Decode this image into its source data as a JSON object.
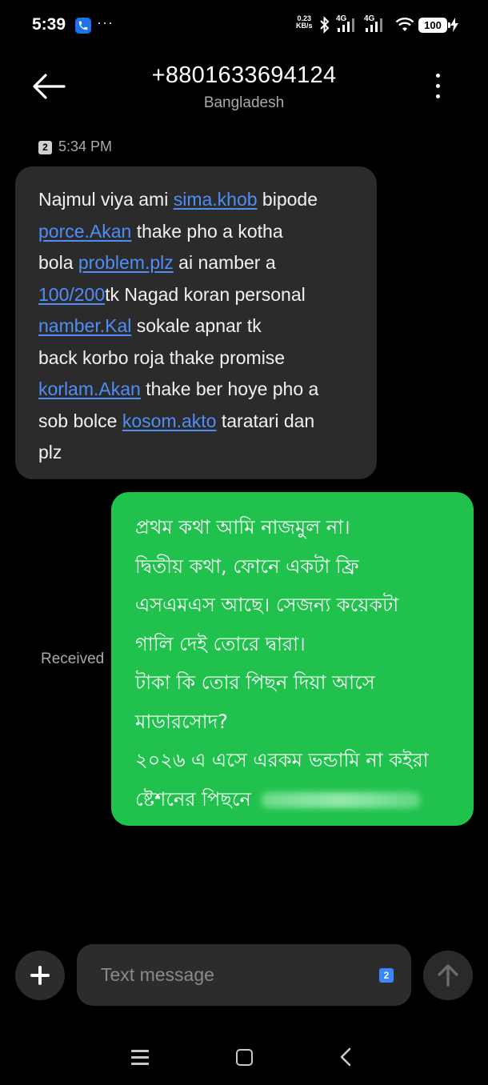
{
  "status_bar": {
    "time": "5:39",
    "more": "···",
    "net_speed_value": "0.23",
    "net_speed_unit": "KB/s",
    "network_1": "4G",
    "network_2": "4G",
    "battery": "100",
    "icons": [
      "call-icon",
      "bluetooth-icon",
      "signal-icon",
      "wifi-icon",
      "battery-icon",
      "charging-icon"
    ]
  },
  "header": {
    "phone_number": "+8801633694124",
    "country": "Bangladesh",
    "icons": [
      "back-arrow-icon",
      "more-vertical-icon"
    ]
  },
  "thread": {
    "sim_label": "2",
    "timestamp": "5:34 PM",
    "incoming": {
      "lines": [
        [
          {
            "t": "Najmul viya ami "
          },
          {
            "t": "sima.khob",
            "link": true
          },
          {
            "t": " bipode"
          }
        ],
        [
          {
            "t": "porce.Akan",
            "link": true
          },
          {
            "t": " thake pho a kotha"
          }
        ],
        [
          {
            "t": "bola "
          },
          {
            "t": "problem.plz",
            "link": true
          },
          {
            "t": " ai namber a"
          }
        ],
        [
          {
            "t": "100/200",
            "link": true
          },
          {
            "t": "tk Nagad koran personal"
          }
        ],
        [
          {
            "t": "namber.Kal",
            "link": true
          },
          {
            "t": " sokale apnar tk"
          }
        ],
        [
          {
            "t": "back korbo roja thake promise"
          }
        ],
        [
          {
            "t": "korlam.Akan",
            "link": true
          },
          {
            "t": " thake ber hoye pho a"
          }
        ],
        [
          {
            "t": "sob bolce "
          },
          {
            "t": "kosom.akto",
            "link": true
          },
          {
            "t": " taratari dan"
          }
        ],
        [
          {
            "t": "plz"
          }
        ]
      ]
    },
    "outgoing": {
      "status": "Received",
      "lines": [
        "প্রথম কথা আমি নাজমুল না।",
        "দ্বিতীয় কথা, ফোনে একটা ফ্রি",
        "এসএমএস আছে। সেজন্য কয়েকটা",
        "গালি দেই তোরে দ্বারা।",
        "টাকা কি তোর পিছন দিয়া আসে",
        "মাডারসোদ?",
        "২০২৬ এ এসে এরকম ভন্ডামি না কইরা",
        "ষ্টেশনের পিছনে"
      ]
    }
  },
  "composer": {
    "placeholder": "Text message",
    "sim_label": "2",
    "icons": [
      "add-icon",
      "send-arrow-icon"
    ]
  },
  "nav": {
    "icons": [
      "recents-icon",
      "home-icon",
      "back-icon"
    ]
  },
  "colors": {
    "background": "#000000",
    "incoming_bubble": "#2b2b2b",
    "outgoing_bubble": "#20c24d",
    "link": "#4f8ef7",
    "secondary_text": "#a9a9a9",
    "sim_badge": "#3a86ff"
  }
}
